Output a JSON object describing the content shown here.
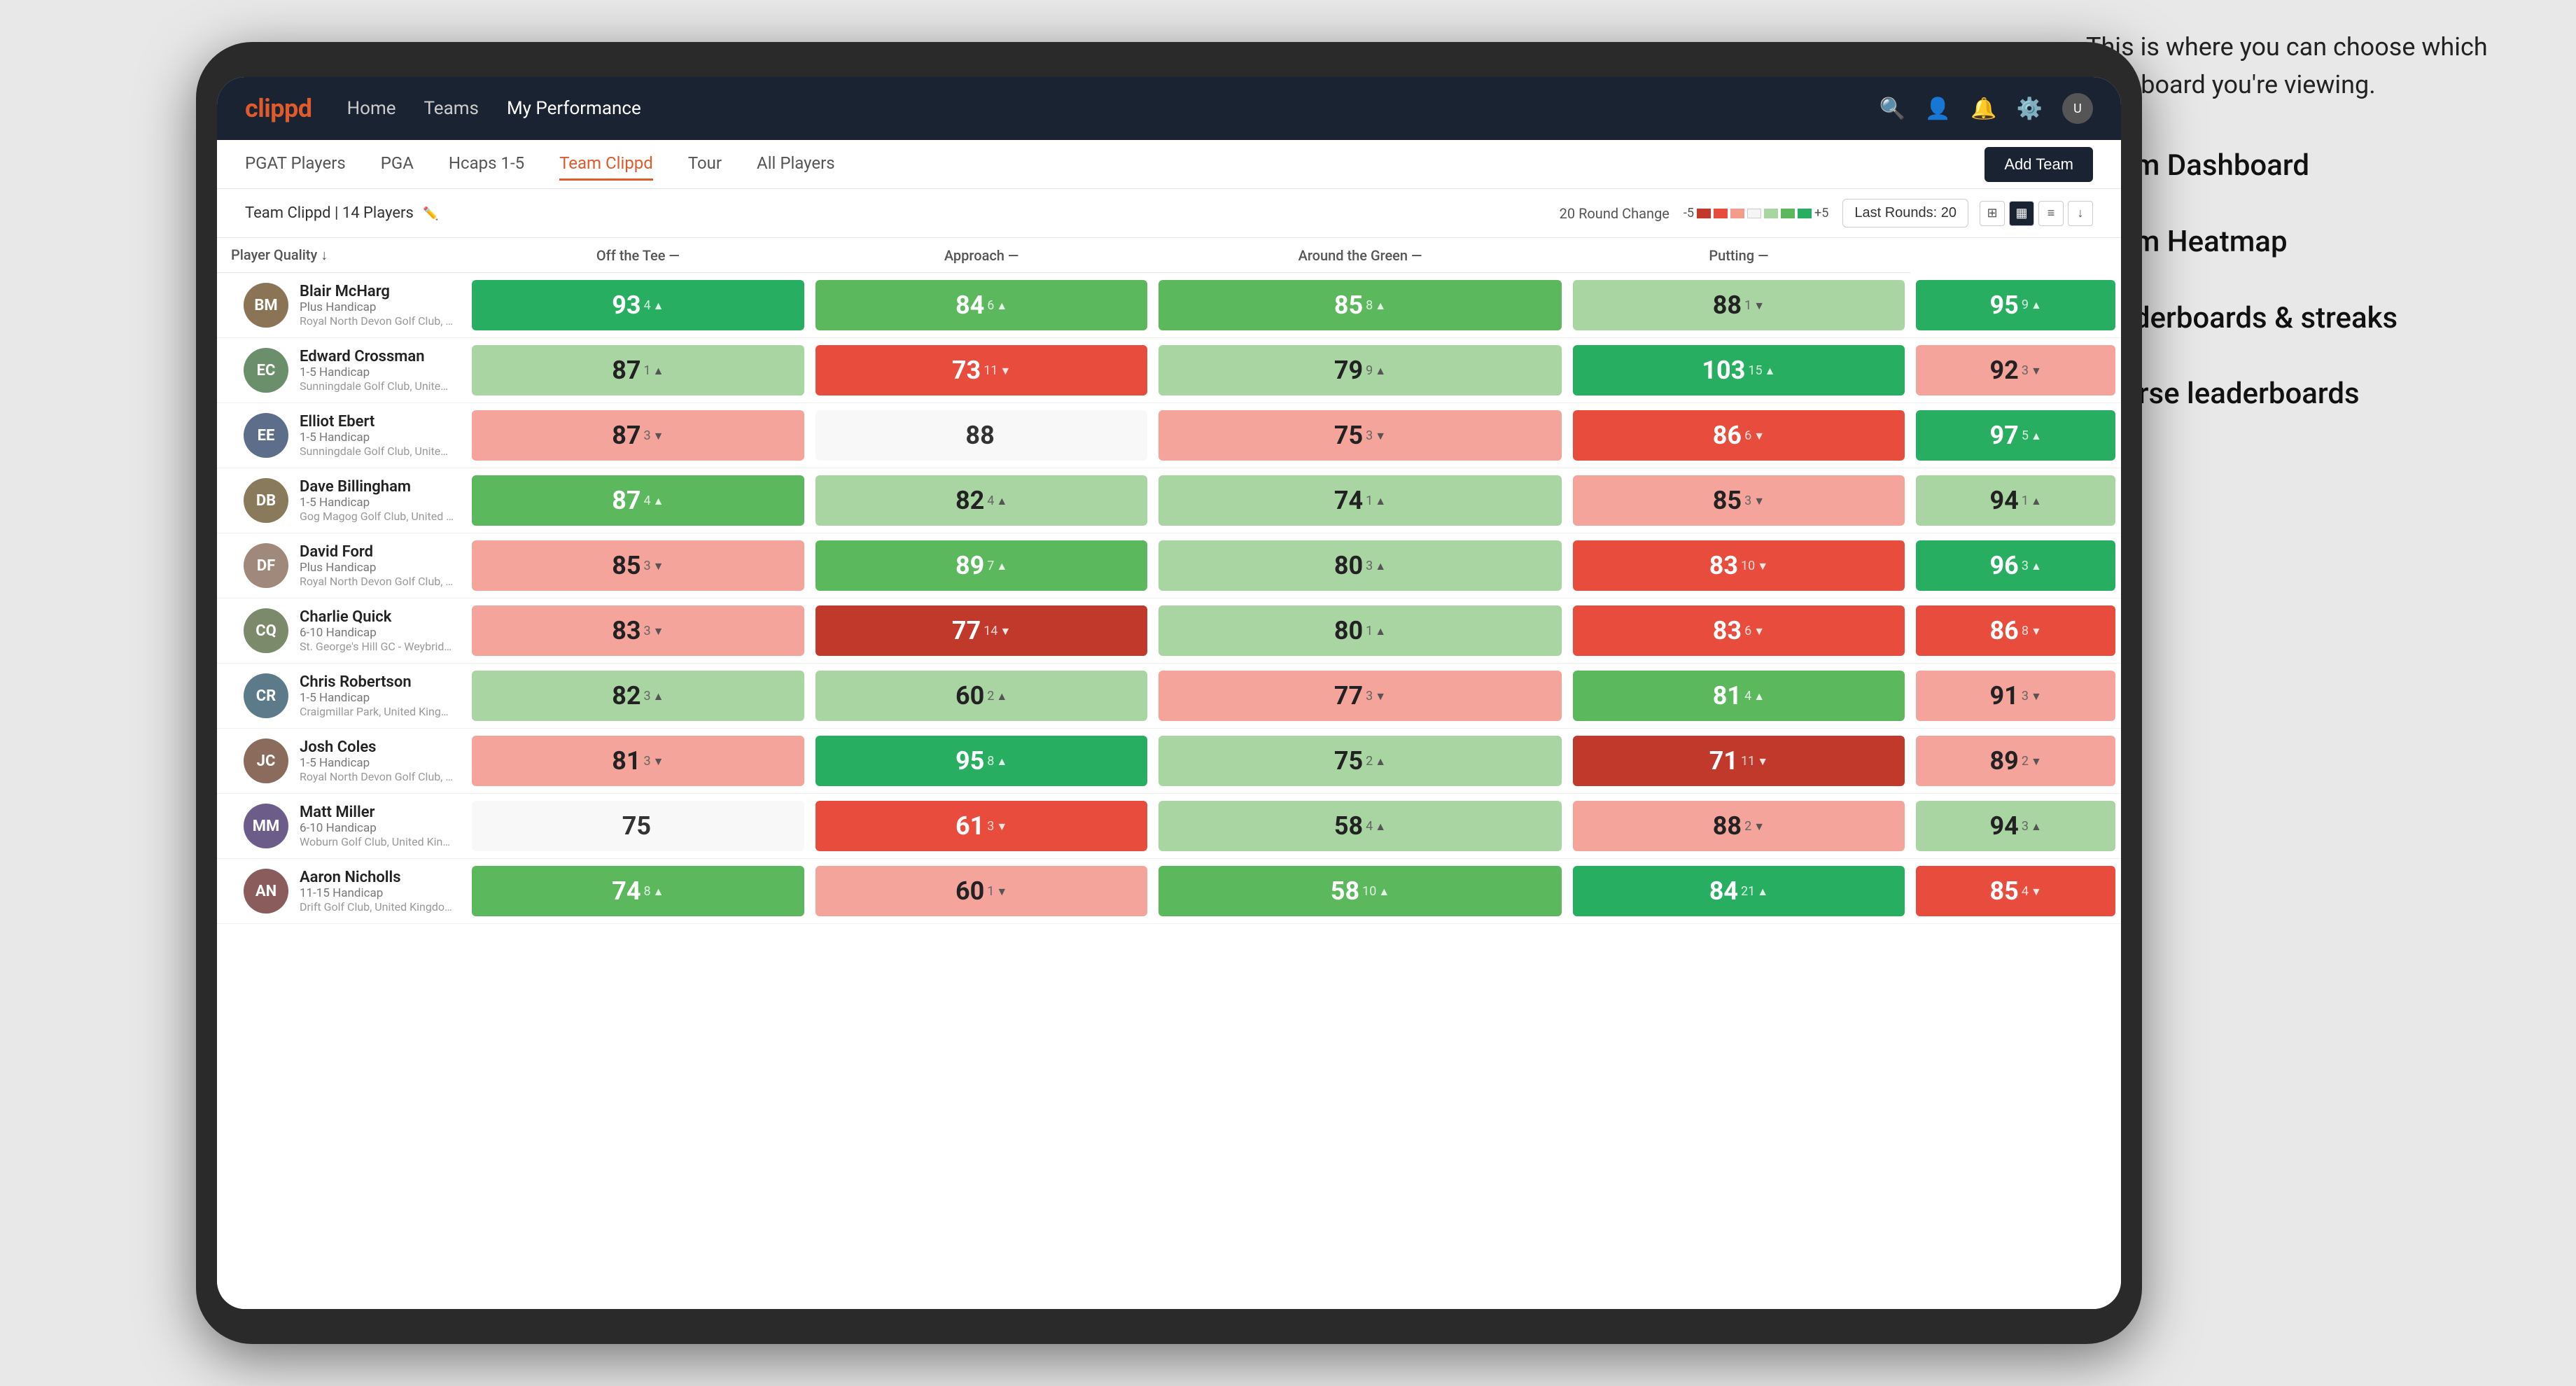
{
  "annotation": {
    "intro": "This is where you can choose which dashboard you're viewing.",
    "items": [
      "Team Dashboard",
      "Team Heatmap",
      "Leaderboards & streaks",
      "Course leaderboards"
    ]
  },
  "nav": {
    "logo": "clippd",
    "links": [
      {
        "label": "Home",
        "active": false
      },
      {
        "label": "Teams",
        "active": false
      },
      {
        "label": "My Performance",
        "active": true
      }
    ],
    "icons": [
      "🔍",
      "👤",
      "🔔",
      "⚙"
    ]
  },
  "sub_nav": {
    "links": [
      {
        "label": "PGAT Players",
        "active": false
      },
      {
        "label": "PGA",
        "active": false
      },
      {
        "label": "Hcaps 1-5",
        "active": false
      },
      {
        "label": "Team Clippd",
        "active": true
      },
      {
        "label": "Tour",
        "active": false
      },
      {
        "label": "All Players",
        "active": false
      }
    ],
    "add_team_label": "Add Team"
  },
  "controls": {
    "team_label": "Team Clippd | 14 Players",
    "round_change_label": "20 Round Change",
    "round_change_neg": "-5",
    "round_change_pos": "+5",
    "last_rounds_label": "Last Rounds: 20"
  },
  "columns": {
    "player": "Player Quality ↓",
    "off_tee": "Off the Tee —",
    "approach": "Approach —",
    "around_green": "Around the Green —",
    "putting": "Putting —"
  },
  "players": [
    {
      "name": "Blair McHarg",
      "handicap": "Plus Handicap",
      "club": "Royal North Devon Golf Club, United Kingdom",
      "avatar_color": "#8B7355",
      "metrics": {
        "player_quality": {
          "value": 93,
          "change": 4,
          "dir": "up",
          "color": "green-strong"
        },
        "off_tee": {
          "value": 84,
          "change": 6,
          "dir": "up",
          "color": "green-mid"
        },
        "approach": {
          "value": 85,
          "change": 8,
          "dir": "up",
          "color": "green-mid"
        },
        "around_green": {
          "value": 88,
          "change": 1,
          "dir": "down",
          "color": "green-light"
        },
        "putting": {
          "value": 95,
          "change": 9,
          "dir": "up",
          "color": "green-strong"
        }
      }
    },
    {
      "name": "Edward Crossman",
      "handicap": "1-5 Handicap",
      "club": "Sunningdale Golf Club, United Kingdom",
      "avatar_color": "#6B8E6B",
      "metrics": {
        "player_quality": {
          "value": 87,
          "change": 1,
          "dir": "up",
          "color": "green-light"
        },
        "off_tee": {
          "value": 73,
          "change": 11,
          "dir": "down",
          "color": "red-mid"
        },
        "approach": {
          "value": 79,
          "change": 9,
          "dir": "up",
          "color": "green-light"
        },
        "around_green": {
          "value": 103,
          "change": 15,
          "dir": "up",
          "color": "green-strong"
        },
        "putting": {
          "value": 92,
          "change": 3,
          "dir": "down",
          "color": "red-light"
        }
      }
    },
    {
      "name": "Elliot Ebert",
      "handicap": "1-5 Handicap",
      "club": "Sunningdale Golf Club, United Kingdom",
      "avatar_color": "#5C6E8A",
      "metrics": {
        "player_quality": {
          "value": 87,
          "change": 3,
          "dir": "down",
          "color": "red-light"
        },
        "off_tee": {
          "value": 88,
          "change": 0,
          "dir": null,
          "color": "neutral"
        },
        "approach": {
          "value": 75,
          "change": 3,
          "dir": "down",
          "color": "red-light"
        },
        "around_green": {
          "value": 86,
          "change": 6,
          "dir": "down",
          "color": "red-mid"
        },
        "putting": {
          "value": 97,
          "change": 5,
          "dir": "up",
          "color": "green-strong"
        }
      }
    },
    {
      "name": "Dave Billingham",
      "handicap": "1-5 Handicap",
      "club": "Gog Magog Golf Club, United Kingdom",
      "avatar_color": "#8A7A5C",
      "metrics": {
        "player_quality": {
          "value": 87,
          "change": 4,
          "dir": "up",
          "color": "green-mid"
        },
        "off_tee": {
          "value": 82,
          "change": 4,
          "dir": "up",
          "color": "green-light"
        },
        "approach": {
          "value": 74,
          "change": 1,
          "dir": "up",
          "color": "green-light"
        },
        "around_green": {
          "value": 85,
          "change": 3,
          "dir": "down",
          "color": "red-light"
        },
        "putting": {
          "value": 94,
          "change": 1,
          "dir": "up",
          "color": "green-light"
        }
      }
    },
    {
      "name": "David Ford",
      "handicap": "Plus Handicap",
      "club": "Royal North Devon Golf Club, United Kingdom",
      "avatar_color": "#A0887A",
      "metrics": {
        "player_quality": {
          "value": 85,
          "change": 3,
          "dir": "down",
          "color": "red-light"
        },
        "off_tee": {
          "value": 89,
          "change": 7,
          "dir": "up",
          "color": "green-mid"
        },
        "approach": {
          "value": 80,
          "change": 3,
          "dir": "up",
          "color": "green-light"
        },
        "around_green": {
          "value": 83,
          "change": 10,
          "dir": "down",
          "color": "red-mid"
        },
        "putting": {
          "value": 96,
          "change": 3,
          "dir": "up",
          "color": "green-strong"
        }
      }
    },
    {
      "name": "Charlie Quick",
      "handicap": "6-10 Handicap",
      "club": "St. George's Hill GC - Weybridge - Surrey, Uni...",
      "avatar_color": "#7A8A6B",
      "metrics": {
        "player_quality": {
          "value": 83,
          "change": 3,
          "dir": "down",
          "color": "red-light"
        },
        "off_tee": {
          "value": 77,
          "change": 14,
          "dir": "down",
          "color": "red-strong"
        },
        "approach": {
          "value": 80,
          "change": 1,
          "dir": "up",
          "color": "green-light"
        },
        "around_green": {
          "value": 83,
          "change": 6,
          "dir": "down",
          "color": "red-mid"
        },
        "putting": {
          "value": 86,
          "change": 8,
          "dir": "down",
          "color": "red-mid"
        }
      }
    },
    {
      "name": "Chris Robertson",
      "handicap": "1-5 Handicap",
      "club": "Craigmillar Park, United Kingdom",
      "avatar_color": "#5C7A8A",
      "metrics": {
        "player_quality": {
          "value": 82,
          "change": 3,
          "dir": "up",
          "color": "green-light"
        },
        "off_tee": {
          "value": 60,
          "change": 2,
          "dir": "up",
          "color": "green-light"
        },
        "approach": {
          "value": 77,
          "change": 3,
          "dir": "down",
          "color": "red-light"
        },
        "around_green": {
          "value": 81,
          "change": 4,
          "dir": "up",
          "color": "green-mid"
        },
        "putting": {
          "value": 91,
          "change": 3,
          "dir": "down",
          "color": "red-light"
        }
      }
    },
    {
      "name": "Josh Coles",
      "handicap": "1-5 Handicap",
      "club": "Royal North Devon Golf Club, United Kingdom",
      "avatar_color": "#8A6B5C",
      "metrics": {
        "player_quality": {
          "value": 81,
          "change": 3,
          "dir": "down",
          "color": "red-light"
        },
        "off_tee": {
          "value": 95,
          "change": 8,
          "dir": "up",
          "color": "green-strong"
        },
        "approach": {
          "value": 75,
          "change": 2,
          "dir": "up",
          "color": "green-light"
        },
        "around_green": {
          "value": 71,
          "change": 11,
          "dir": "down",
          "color": "red-strong"
        },
        "putting": {
          "value": 89,
          "change": 2,
          "dir": "down",
          "color": "red-light"
        }
      }
    },
    {
      "name": "Matt Miller",
      "handicap": "6-10 Handicap",
      "club": "Woburn Golf Club, United Kingdom",
      "avatar_color": "#6B5C8A",
      "metrics": {
        "player_quality": {
          "value": 75,
          "change": 0,
          "dir": null,
          "color": "neutral"
        },
        "off_tee": {
          "value": 61,
          "change": 3,
          "dir": "down",
          "color": "red-mid"
        },
        "approach": {
          "value": 58,
          "change": 4,
          "dir": "up",
          "color": "green-light"
        },
        "around_green": {
          "value": 88,
          "change": 2,
          "dir": "down",
          "color": "red-light"
        },
        "putting": {
          "value": 94,
          "change": 3,
          "dir": "up",
          "color": "green-light"
        }
      }
    },
    {
      "name": "Aaron Nicholls",
      "handicap": "11-15 Handicap",
      "club": "Drift Golf Club, United Kingdom",
      "avatar_color": "#8A5C5C",
      "metrics": {
        "player_quality": {
          "value": 74,
          "change": 8,
          "dir": "up",
          "color": "green-mid"
        },
        "off_tee": {
          "value": 60,
          "change": 1,
          "dir": "down",
          "color": "red-light"
        },
        "approach": {
          "value": 58,
          "change": 10,
          "dir": "up",
          "color": "green-mid"
        },
        "around_green": {
          "value": 84,
          "change": 21,
          "dir": "up",
          "color": "green-strong"
        },
        "putting": {
          "value": 85,
          "change": 4,
          "dir": "down",
          "color": "red-mid"
        }
      }
    }
  ]
}
